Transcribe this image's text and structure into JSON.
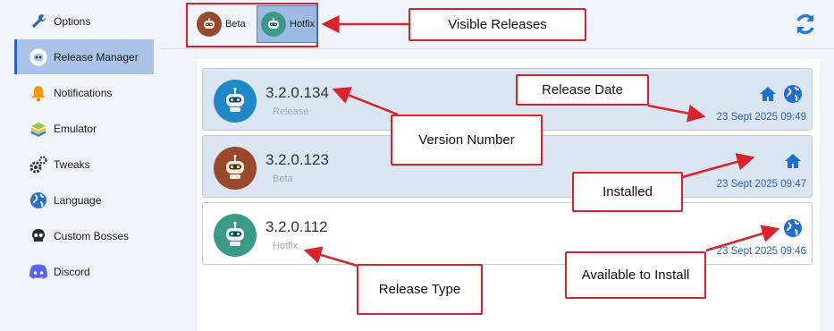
{
  "sidebar": {
    "items": [
      {
        "label": "Options",
        "icon": "wrench-icon"
      },
      {
        "label": "Release Manager",
        "icon": "robot-icon",
        "active": true
      },
      {
        "label": "Notifications",
        "icon": "bell-icon"
      },
      {
        "label": "Emulator",
        "icon": "layers-icon"
      },
      {
        "label": "Tweaks",
        "icon": "gears-icon"
      },
      {
        "label": "Language",
        "icon": "globe-icon"
      },
      {
        "label": "Custom Bosses",
        "icon": "skull-icon"
      },
      {
        "label": "Discord",
        "icon": "discord-icon"
      }
    ]
  },
  "filters": [
    {
      "label": "Beta",
      "selected": false
    },
    {
      "label": "Hotfix",
      "selected": true
    }
  ],
  "toolbar": {
    "refresh_icon": "refresh-icon"
  },
  "releases": [
    {
      "version": "3.2.0.134",
      "type": "Release",
      "date": "23 Sept 2025 09:49",
      "installed": true,
      "available": true,
      "color": "#1e88c8"
    },
    {
      "version": "3.2.0.123",
      "type": "Beta",
      "date": "23 Sept 2025 09:47",
      "installed": true,
      "available": false,
      "color": "#9a4a2c"
    },
    {
      "version": "3.2.0.112",
      "type": "Hotfix",
      "date": "23 Sept 2025 09:46",
      "installed": false,
      "available": true,
      "color": "#3b9a86"
    }
  ],
  "annotations": {
    "visible_releases": "Visible Releases",
    "release_date": "Release Date",
    "version_number": "Version Number",
    "installed": "Installed",
    "release_type": "Release Type",
    "available_to_install": "Available to Install"
  },
  "colors": {
    "accent": "#2a63b8",
    "annotation": "#d8232a",
    "active_bg": "#a9c3e6"
  }
}
